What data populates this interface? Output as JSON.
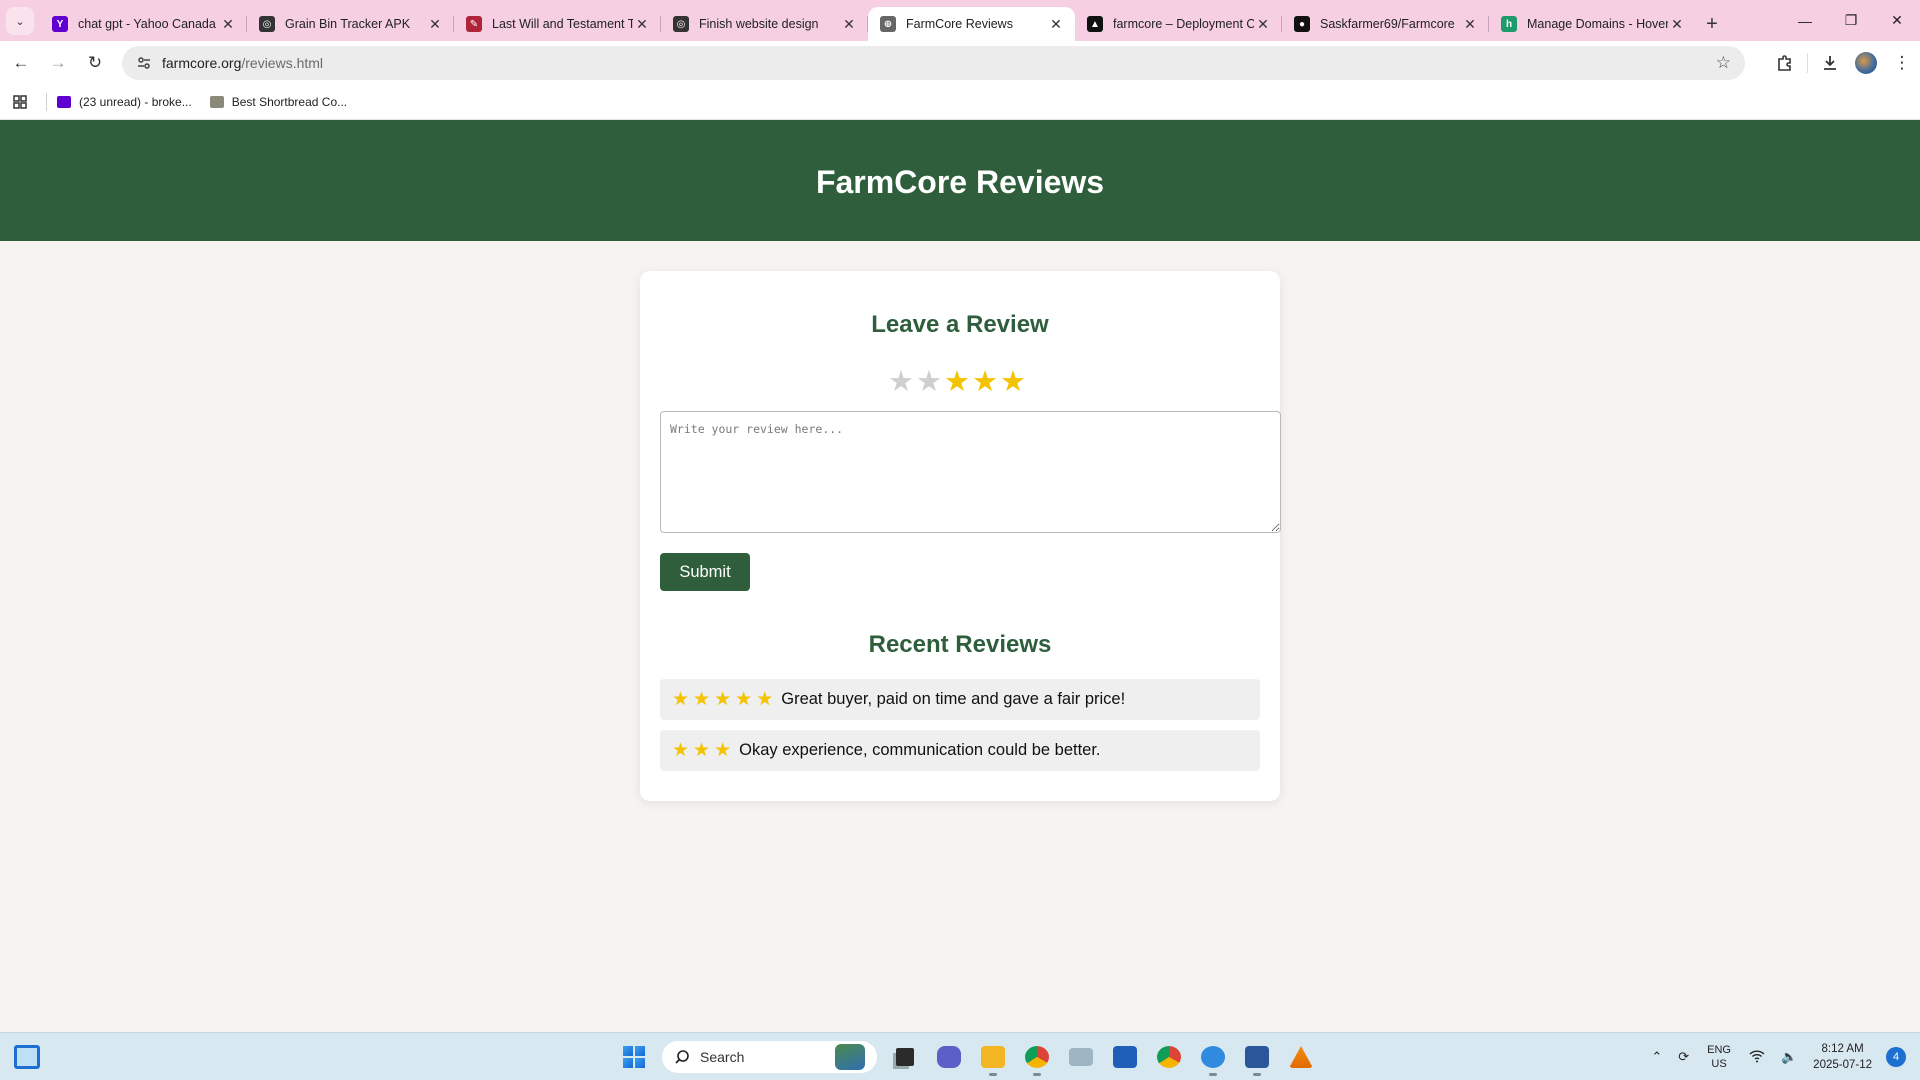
{
  "browser": {
    "tabs": [
      {
        "title": "chat gpt - Yahoo Canada S",
        "favicon_color": "#6001d2",
        "favicon_glyph": "Y",
        "active": false
      },
      {
        "title": "Grain Bin Tracker APK",
        "favicon_color": "#333333",
        "favicon_glyph": "◎",
        "active": false
      },
      {
        "title": "Last Will and Testament Te",
        "favicon_color": "#b0243a",
        "favicon_glyph": "✎",
        "active": false
      },
      {
        "title": "Finish website design",
        "favicon_color": "#333333",
        "favicon_glyph": "◎",
        "active": false
      },
      {
        "title": "FarmCore Reviews",
        "favicon_color": "#666666",
        "favicon_glyph": "⊕",
        "active": true
      },
      {
        "title": "farmcore – Deployment O",
        "favicon_color": "#111111",
        "favicon_glyph": "▲",
        "active": false
      },
      {
        "title": "Saskfarmer69/Farmcore",
        "favicon_color": "#111111",
        "favicon_glyph": "●",
        "active": false
      },
      {
        "title": "Manage Domains - Hover",
        "favicon_color": "#1e9b6d",
        "favicon_glyph": "h",
        "active": false
      }
    ],
    "url_domain": "farmcore.org",
    "url_path": "/reviews.html",
    "bookmarks": [
      {
        "label": "(23 unread) - broke...",
        "favicon_color": "#6001d2"
      },
      {
        "label": "Best Shortbread Co...",
        "favicon_color": "#8a8a7a"
      }
    ]
  },
  "page": {
    "header_title": "FarmCore Reviews",
    "leave_heading": "Leave a Review",
    "rating": {
      "max": 5,
      "selected": 3
    },
    "review_placeholder": "Write your review here...",
    "submit_label": "Submit",
    "recent_heading": "Recent Reviews",
    "reviews": [
      {
        "stars": 5,
        "text": "Great buyer, paid on time and gave a fair price!"
      },
      {
        "stars": 3,
        "text": "Okay experience, communication could be better."
      }
    ],
    "star_color": "#f3c300",
    "brand_color": "#2e5e3b"
  },
  "taskbar": {
    "search_label": "Search",
    "lang_line1": "ENG",
    "lang_line2": "US",
    "time": "8:12 AM",
    "date": "2025-07-12",
    "notifications": "4"
  }
}
